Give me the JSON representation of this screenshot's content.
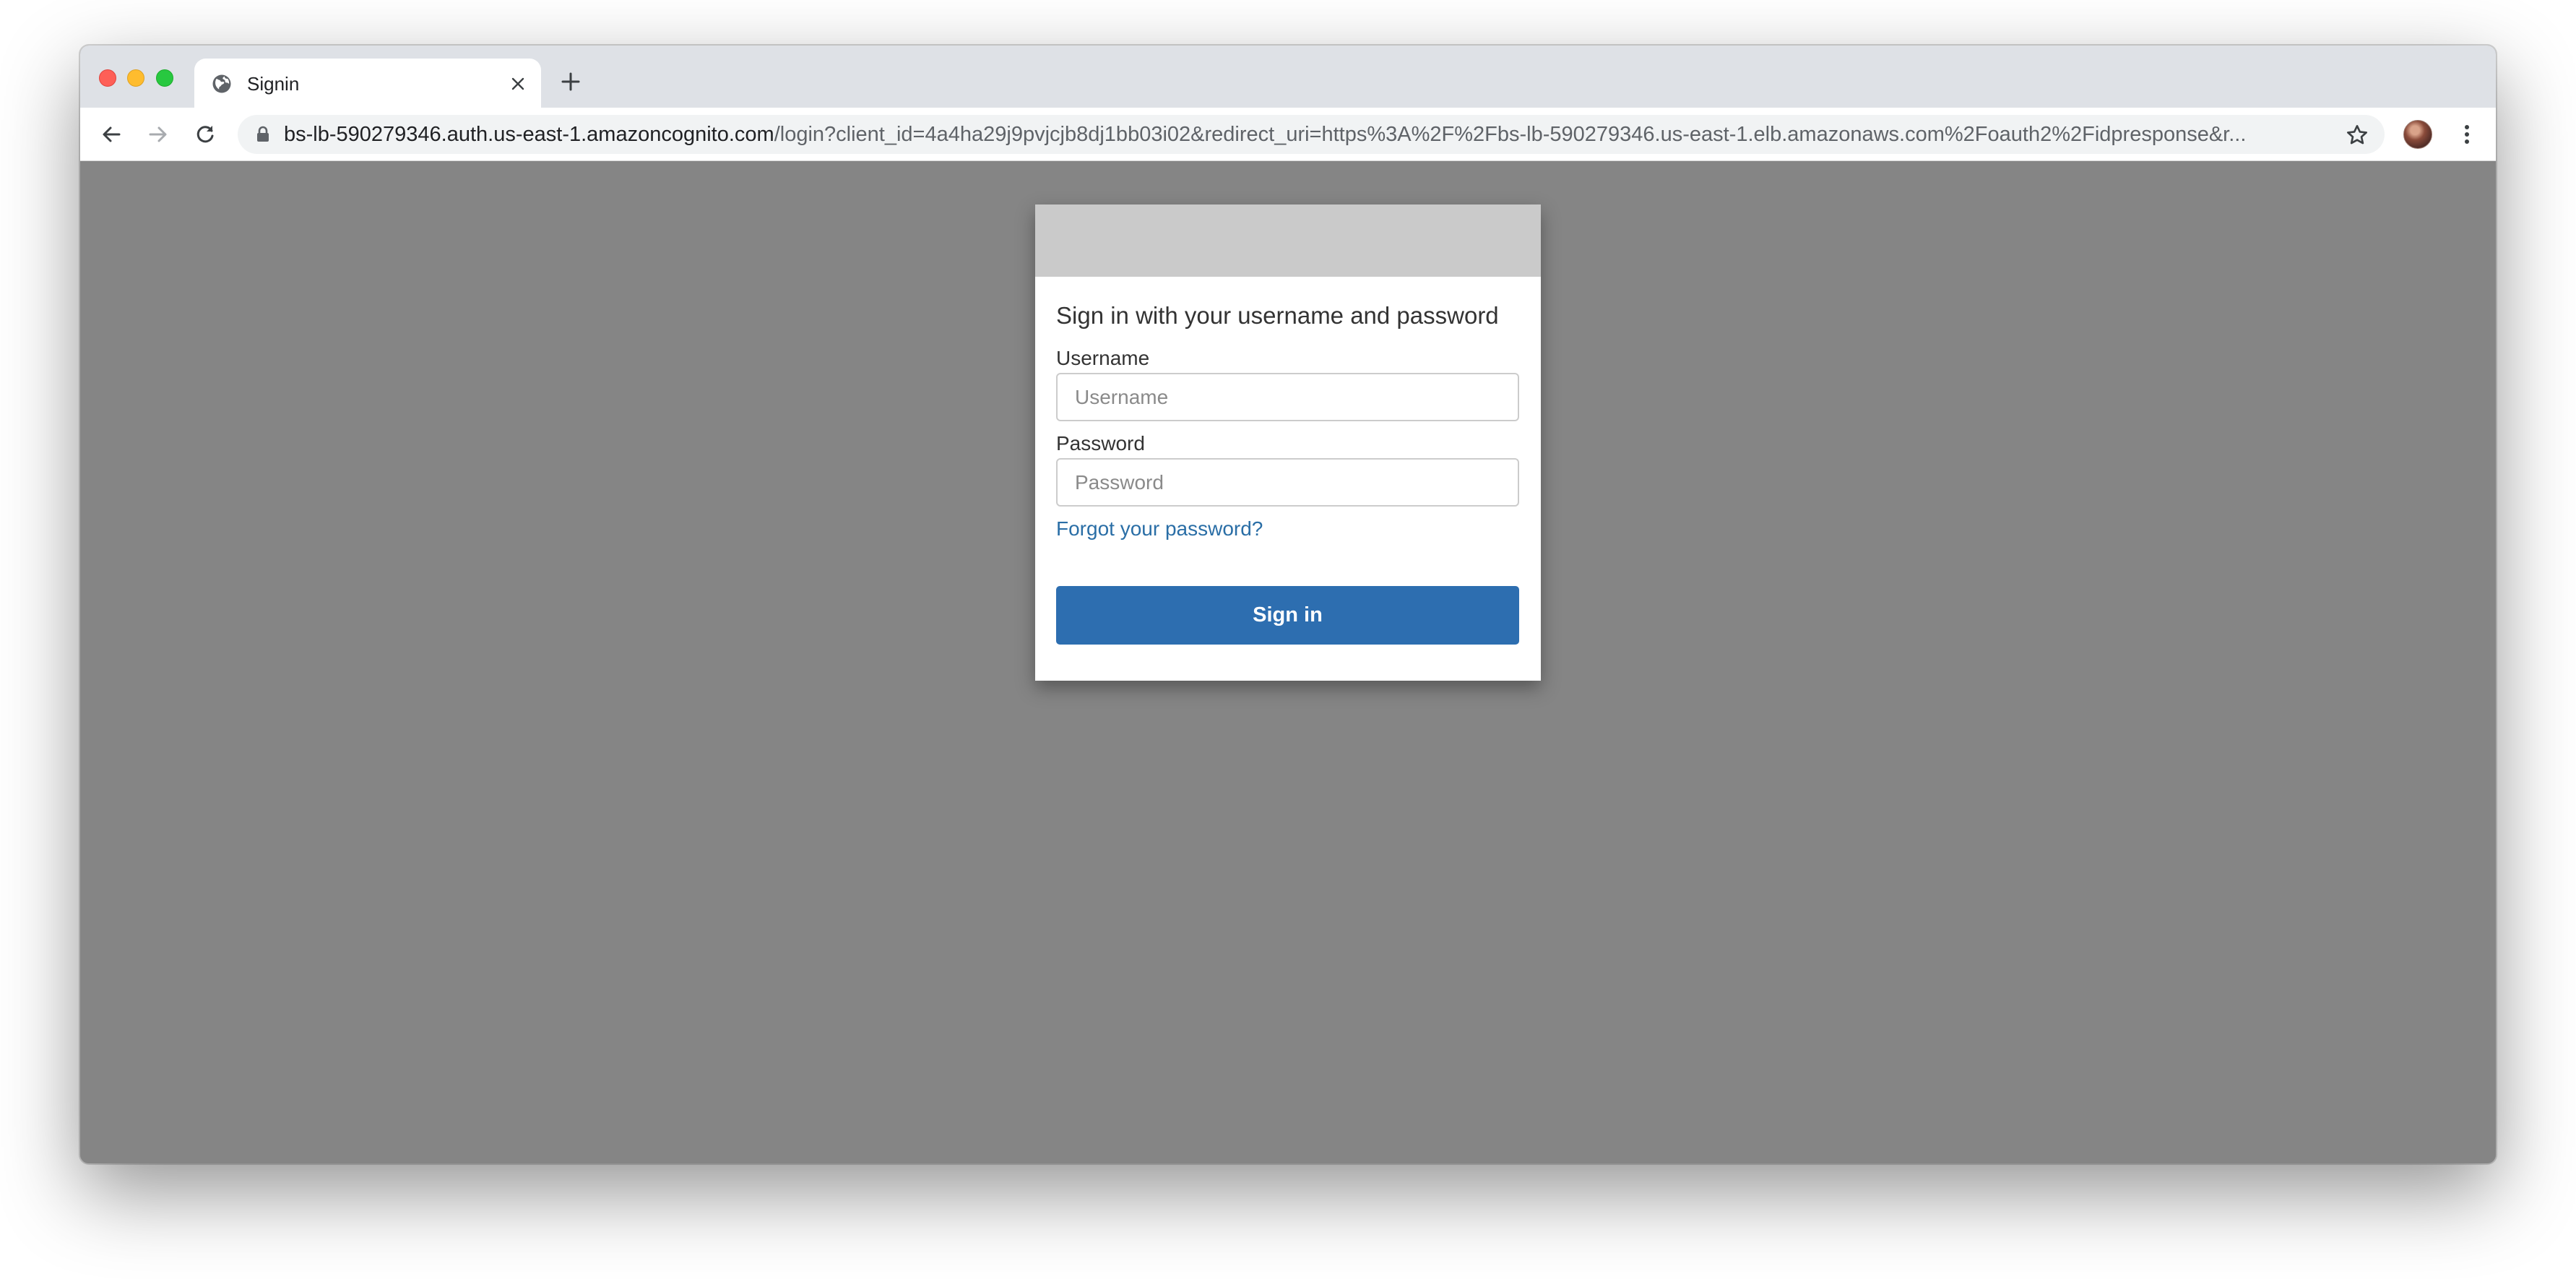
{
  "browser": {
    "tab": {
      "title": "Signin",
      "icon": "globe-icon"
    },
    "address_bar": {
      "host": "bs-lb-590279346.auth.us-east-1.amazoncognito.com",
      "path": "/login?client_id=4a4ha29j9pvjcjb8dj1bb03i02&redirect_uri=https%3A%2F%2Fbs-lb-590279346.us-east-1.elb.amazonaws.com%2Foauth2%2Fidpresponse&r..."
    },
    "icons": {
      "back": "back-arrow-icon",
      "forward": "forward-arrow-icon",
      "reload": "reload-icon",
      "lock": "lock-icon",
      "bookmark": "star-icon",
      "profile": "avatar",
      "menu": "kebab-menu-icon",
      "new_tab": "plus-icon",
      "close_tab": "close-icon"
    }
  },
  "login": {
    "heading": "Sign in with your username and password",
    "username_label": "Username",
    "username_placeholder": "Username",
    "username_value": "",
    "password_label": "Password",
    "password_placeholder": "Password",
    "password_value": "",
    "forgot_link": "Forgot your password?",
    "submit_label": "Sign in"
  },
  "colors": {
    "page_background": "#858585",
    "banner": "#cacaca",
    "primary_button": "#2d6eb0",
    "link": "#2a6ea6"
  }
}
